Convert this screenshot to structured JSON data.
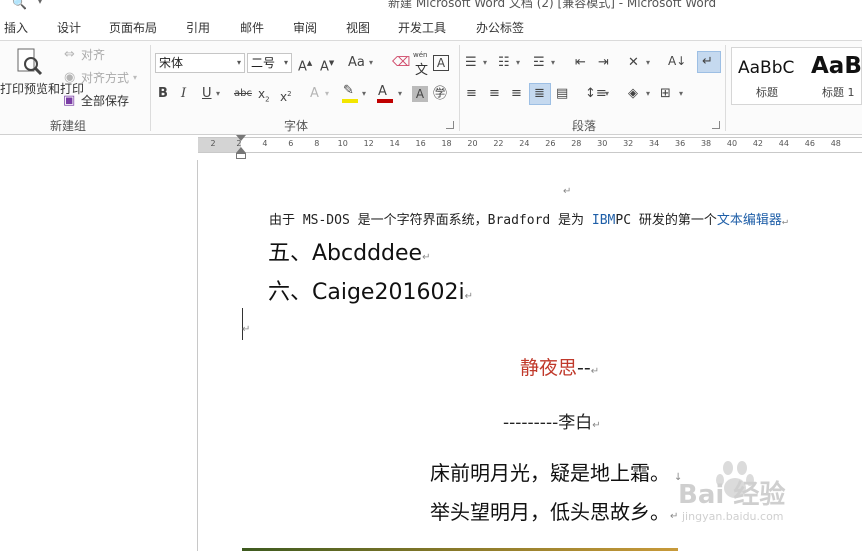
{
  "window": {
    "title": "新建 Microsoft Word 文档 (2) [兼容模式] - Microsoft Word"
  },
  "tabs": [
    "插入",
    "设计",
    "页面布局",
    "引用",
    "邮件",
    "审阅",
    "视图",
    "开发工具",
    "办公标签"
  ],
  "ribbon": {
    "new_group": {
      "print_preview_label": "打印预览和打印",
      "align_label": "对齐",
      "align_mode_label": "对齐方式",
      "save_all_label": "全部保存",
      "group_label": "新建组"
    },
    "font_group": {
      "font_name": "宋体",
      "font_size": "二号",
      "group_label": "字体",
      "phonetic_label": "wén"
    },
    "paragraph_group": {
      "group_label": "段落"
    },
    "styles": [
      {
        "sample": "AaBbC",
        "name": "标题"
      },
      {
        "sample": "AaBl",
        "name": "标题 1"
      }
    ]
  },
  "ruler": {
    "labels": [
      "2",
      "2",
      "4",
      "6",
      "8",
      "10",
      "12",
      "14",
      "16",
      "18",
      "20",
      "22",
      "24",
      "26",
      "28",
      "30",
      "32",
      "34",
      "36",
      "38",
      "40",
      "42",
      "44",
      "46",
      "48"
    ]
  },
  "document": {
    "line1": {
      "prefix": "由于 MS-DOS 是一个字符界面系统，Bradford 是为 ",
      "ibm": "IBM",
      "middle": "PC 研发的第一个",
      "link": "文本编辑器"
    },
    "heading5": "五、Abcdddee",
    "heading6": "六、Caige201602i",
    "poem_title": "静夜思",
    "poem_title_dash": "--",
    "poem_author": "---------李白",
    "poem_line1": "床前明月光，疑是地上霜。",
    "poem_line2": "举头望明月，低头思故乡。",
    "paragraph_mark": "↵",
    "cursor_mark": "↓"
  },
  "colors": {
    "link_blue": "#1f5fa8",
    "poem_title": "#c0392b",
    "active_button": "#c5d9ef",
    "underline_red": "#c00000",
    "highlight_yellow": "#f3e600"
  },
  "watermark": {
    "brand": "Bai 经验",
    "url": "jingyan.baidu.com"
  }
}
